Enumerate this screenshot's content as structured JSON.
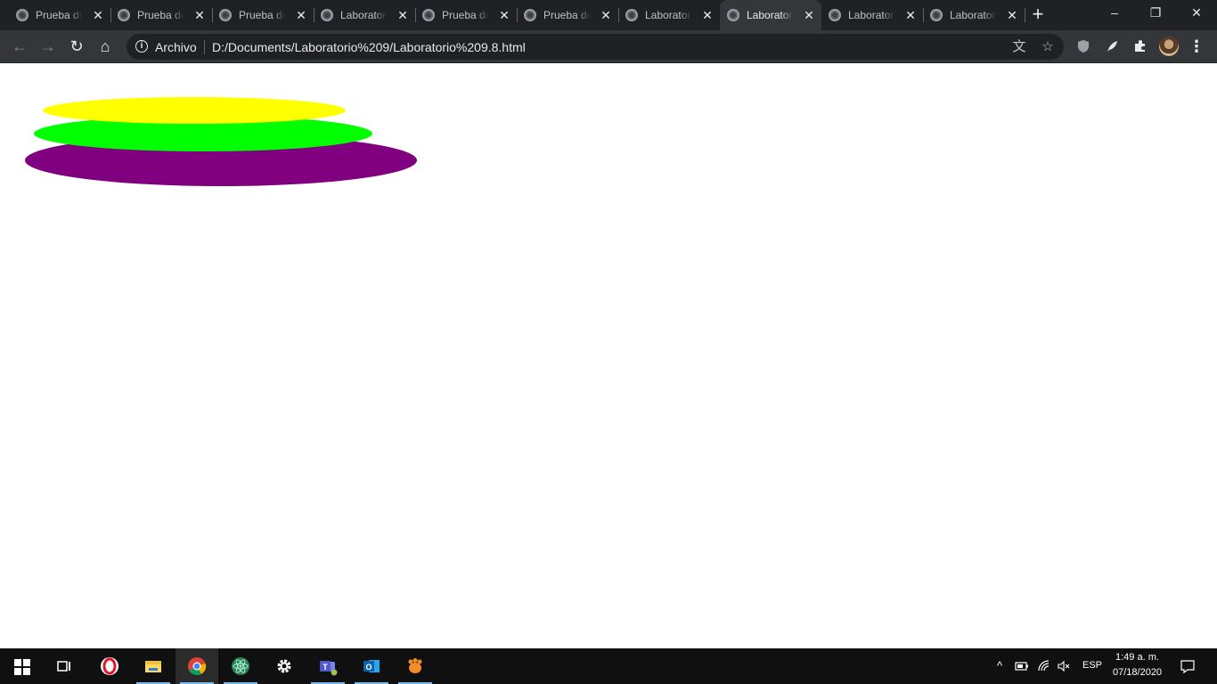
{
  "tabs": [
    {
      "title": "Prueba de"
    },
    {
      "title": "Prueba de"
    },
    {
      "title": "Prueba de"
    },
    {
      "title": "Laboratorio"
    },
    {
      "title": "Prueba de"
    },
    {
      "title": "Prueba de"
    },
    {
      "title": "Laboratorio"
    },
    {
      "title": "Laboratorio",
      "active": true
    },
    {
      "title": "Laboratorio"
    },
    {
      "title": "Laboratorio"
    }
  ],
  "window": {
    "minimize_glyph": "–",
    "restore_glyph": "❐",
    "close_glyph": "✕",
    "newtab_glyph": "+"
  },
  "toolbar": {
    "back_glyph": "←",
    "forward_glyph": "→",
    "reload_glyph": "↻",
    "home_glyph": "⌂",
    "info_glyph": "i",
    "scheme_label": "Archivo",
    "url": "D:/Documents/Laboratorio%209/Laboratorio%209.8.html",
    "translate_glyph": "文",
    "star_glyph": "☆",
    "menu_glyph": "⋮"
  },
  "shapes": {
    "bottom_color": "#800080",
    "middle_color": "#00ff00",
    "top_color": "#ffff00"
  },
  "taskbar": {
    "apps": [
      "windows-start",
      "task-view",
      "opera",
      "file-explorer",
      "chrome",
      "atom",
      "settings",
      "teams",
      "outlook",
      "scratch"
    ],
    "language": "ESP",
    "time": "1:49 a. m.",
    "date": "07/18/2020"
  }
}
